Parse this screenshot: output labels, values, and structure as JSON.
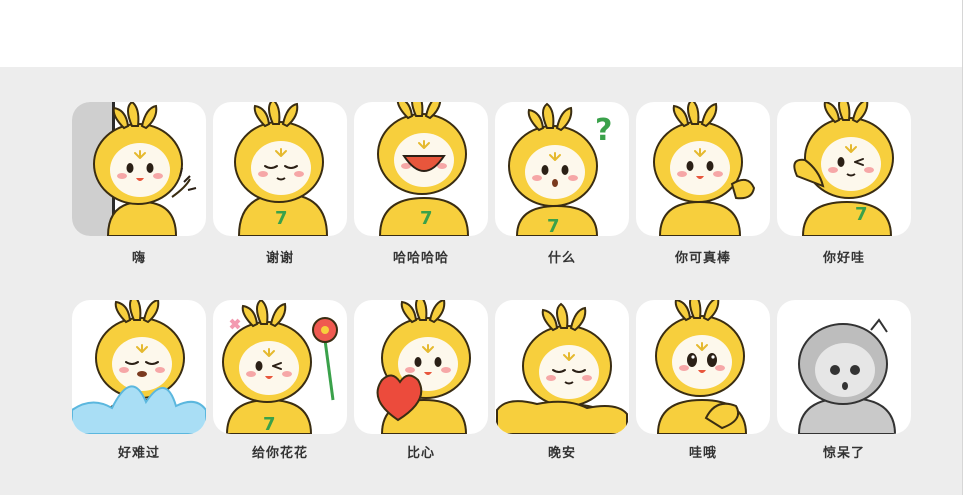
{
  "stickers": [
    {
      "label": "嗨",
      "icon": "mascot-peek-wave-icon"
    },
    {
      "label": "谢谢",
      "icon": "mascot-thanks-icon"
    },
    {
      "label": "哈哈哈哈",
      "icon": "mascot-laugh-icon"
    },
    {
      "label": "什么",
      "icon": "mascot-question-icon"
    },
    {
      "label": "你可真棒",
      "icon": "mascot-thumbs-up-icon"
    },
    {
      "label": "你好哇",
      "icon": "mascot-hello-icon"
    },
    {
      "label": "好难过",
      "icon": "mascot-cry-icon"
    },
    {
      "label": "给你花花",
      "icon": "mascot-flower-icon"
    },
    {
      "label": "比心",
      "icon": "mascot-heart-icon"
    },
    {
      "label": "晚安",
      "icon": "mascot-sleep-icon"
    },
    {
      "label": "哇哦",
      "icon": "mascot-wow-icon"
    },
    {
      "label": "惊呆了",
      "icon": "mascot-shocked-icon"
    }
  ],
  "colors": {
    "mascot_body": "#f7cf3d",
    "mascot_face": "#fdf8ec",
    "panel_bg": "#ededed",
    "label_text": "#333333"
  }
}
